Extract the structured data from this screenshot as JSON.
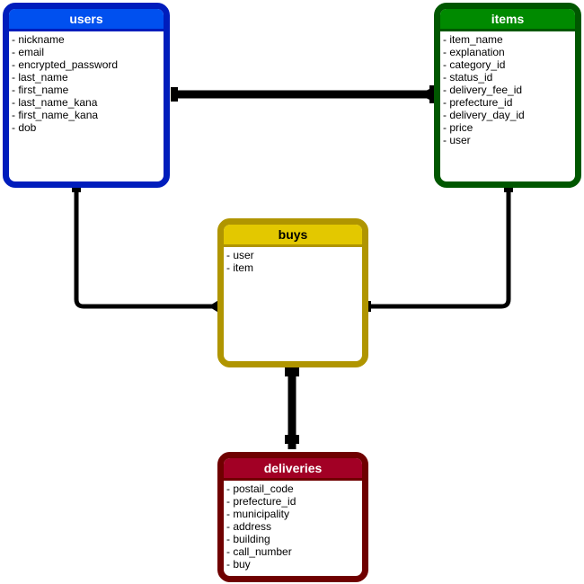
{
  "entities": {
    "users": {
      "title": "users",
      "header_color": "#0050ef",
      "border_color": "#001dbc",
      "fields": [
        "- nickname",
        "- email",
        "- encrypted_password",
        "- last_name",
        "- first_name",
        "- last_name_kana",
        "- first_name_kana",
        "- dob"
      ]
    },
    "items": {
      "title": "items",
      "header_color": "#008a00",
      "border_color": "#005700",
      "fields": [
        "- item_name",
        "- explanation",
        "- category_id",
        "- status_id",
        "- delivery_fee_id",
        "- prefecture_id",
        "- delivery_day_id",
        "- price",
        "- user"
      ]
    },
    "buys": {
      "title": "buys",
      "header_color": "#e3c800",
      "border_color": "#b09500",
      "fields": [
        "- user",
        "- item"
      ]
    },
    "deliveries": {
      "title": "deliveries",
      "header_color": "#a20025",
      "border_color": "#6f0000",
      "fields": [
        "- postail_code",
        "- prefecture_id",
        "- municipality",
        "- address",
        "- building",
        "- call_number",
        "- buy"
      ]
    }
  },
  "relationships": [
    {
      "from": "users",
      "to": "items",
      "from_end": "one",
      "to_end": "many"
    },
    {
      "from": "users",
      "to": "buys",
      "from_end": "one",
      "to_end": "many"
    },
    {
      "from": "items",
      "to": "buys",
      "from_end": "one",
      "to_end": "one"
    },
    {
      "from": "buys",
      "to": "deliveries",
      "from_end": "one",
      "to_end": "one"
    }
  ]
}
